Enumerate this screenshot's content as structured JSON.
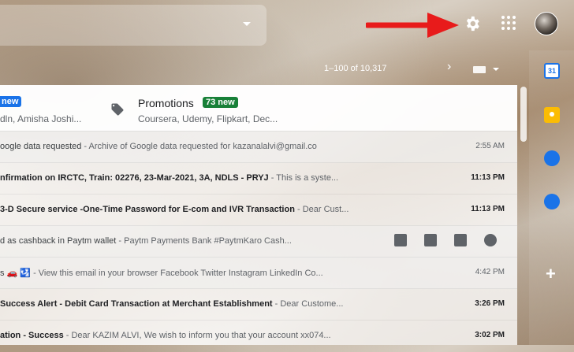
{
  "header": {
    "settings_icon": "gear-icon",
    "apps_icon": "apps-grid-icon",
    "avatar_icon": "user-avatar"
  },
  "toolbar": {
    "pagination": "1–100 of 10,317"
  },
  "tabs": {
    "primary": {
      "badge": "new",
      "senders": "dln, Amisha Joshi..."
    },
    "promotions": {
      "label": "Promotions",
      "badge": "73 new",
      "senders": "Coursera, Udemy, Flipkart, Dec..."
    }
  },
  "emails": [
    {
      "subject": "oogle data requested",
      "snippet": " - Archive of Google data requested for kazanalalvi@gmail.co",
      "time": "2:55 AM",
      "read": true
    },
    {
      "subject": "nfirmation on IRCTC, Train: 02276, 23-Mar-2021, 3A, NDLS - PRYJ",
      "snippet": " - This is a syste...",
      "time": "11:13 PM",
      "read": false
    },
    {
      "subject": "3-D Secure service -One-Time Password for E-com and IVR Transaction",
      "snippet": " - Dear Cust...",
      "time": "11:13 PM",
      "read": false
    },
    {
      "subject": "d as cashback in Paytm wallet",
      "snippet": " - Paytm Payments Bank #PaytmKaro Cash...",
      "time": "",
      "read": true
    },
    {
      "subject": "s 🚗 🛂",
      "snippet": " - View this email in your browser Facebook Twitter Instagram LinkedIn Co...",
      "time": "4:42 PM",
      "read": true
    },
    {
      "subject": "Success Alert - Debit Card Transaction at Merchant Establishment",
      "snippet": " - Dear Custome...",
      "time": "3:26 PM",
      "read": false
    },
    {
      "subject": "ation - Success",
      "snippet": " - Dear KAZIM ALVI, We wish to inform you that your account xx074...",
      "time": "3:02 PM",
      "read": false
    }
  ],
  "right_panel": {
    "calendar_label": "31",
    "add_label": "+"
  },
  "colors": {
    "primary_badge": "#1a73e8",
    "promotions_badge": "#188038",
    "arrow": "#e81b1b"
  }
}
